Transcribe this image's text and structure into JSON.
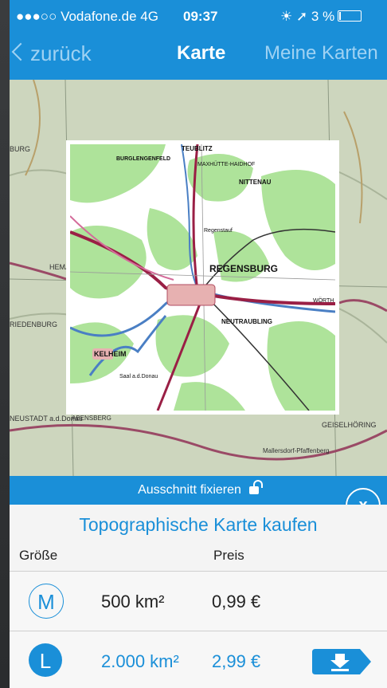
{
  "status_bar": {
    "carrier": "●●●○○ Vodafone.de  4G",
    "time": "09:37",
    "right": "☀ ➚ 3 %"
  },
  "nav": {
    "back_label": "zurück",
    "title": "Karte",
    "right_label": "Meine Karten"
  },
  "map": {
    "labels": {
      "regensburg": "REGENSBURG",
      "kelheim": "KELHEIM",
      "neutraubling": "NEUTRAUBLING",
      "nittenau": "NITTENAU",
      "teublitz": "TEUBLITZ",
      "burglengenfeld": "BURGLENGENFELD",
      "maxhuette": "MAXHÜTTE-HAIDHOF",
      "regenstauf": "Regenstauf",
      "woerth": "WÖRTH",
      "saal": "Saal a.d.Donau",
      "abensberg": "ABENSBERG",
      "neustadt": "NEUSTADT a.d.Donau",
      "geiselhoering": "GEISELHÖRING",
      "mallersdorf": "Mallersdorf-Pfaffenberg",
      "hemau": "HEMAU",
      "riedenburg": "RIEDENBURG",
      "burg": "BURG"
    }
  },
  "fix_bar": {
    "label": "Ausschnitt fixieren"
  },
  "close_label": "x",
  "purchase": {
    "title": "Topographische Karte kaufen",
    "col_size": "Größe",
    "col_price": "Preis",
    "options": [
      {
        "code": "M",
        "size": "500 km²",
        "price": "0,99 €"
      },
      {
        "code": "L",
        "size": "2.000 km²",
        "price": "2,99 €"
      }
    ]
  },
  "colors": {
    "accent": "#1a8fd8"
  }
}
